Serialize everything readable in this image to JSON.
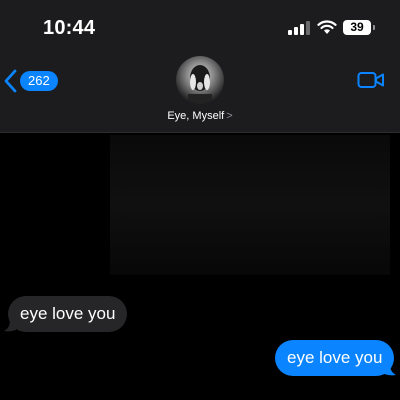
{
  "status_bar": {
    "time": "10:44",
    "battery": "39"
  },
  "nav": {
    "back_count": "262",
    "contact_name": "Eye, Myself",
    "chevron": ">"
  },
  "messages": [
    {
      "direction": "received",
      "text": "eye love you"
    },
    {
      "direction": "sent",
      "text": "eye love you"
    }
  ],
  "colors": {
    "accent": "#0a84ff",
    "received_bubble": "#262628",
    "header_bg": "#1c1c1e"
  },
  "icons": [
    "back-chevron-icon",
    "video-camera-icon",
    "signal-icon",
    "wifi-icon",
    "battery-icon"
  ]
}
